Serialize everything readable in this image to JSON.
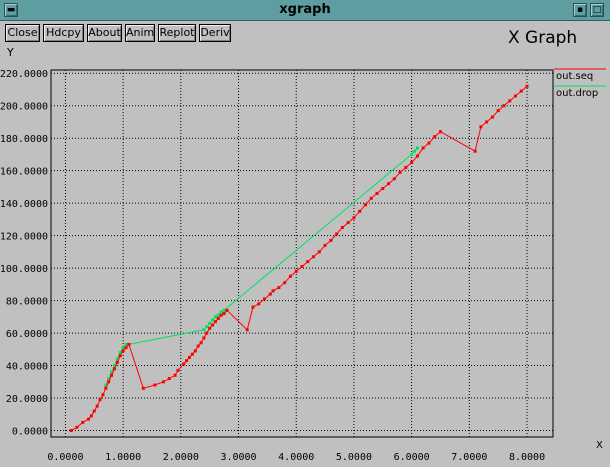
{
  "window": {
    "title": "xgraph"
  },
  "buttons": [
    "Close",
    "Hdcpy",
    "About",
    "Anim",
    "Replot",
    "Deriv"
  ],
  "graph": {
    "title": "X Graph",
    "ylabel": "Y",
    "xlabel": "X"
  },
  "colors": {
    "seq": "#ff0000",
    "drop": "#00e060",
    "grid": "#000000",
    "background": "#c0c0c0",
    "titlebar": "#5f9ea0"
  },
  "chart_data": {
    "type": "line",
    "title": "X Graph",
    "xlabel": "X",
    "ylabel": "Y",
    "xlim": [
      -0.25,
      8.45
    ],
    "ylim": [
      -4,
      222
    ],
    "grid": true,
    "legend_position": "top-right",
    "xticks": [
      "0.0000",
      "1.0000",
      "2.0000",
      "3.0000",
      "4.0000",
      "5.0000",
      "6.0000",
      "7.0000",
      "8.0000"
    ],
    "yticks": [
      "0.0000",
      "20.0000",
      "40.0000",
      "60.0000",
      "80.0000",
      "100.0000",
      "120.0000",
      "140.0000",
      "160.0000",
      "180.0000",
      "200.0000",
      "220.0000"
    ],
    "series": [
      {
        "name": "out.seq",
        "color": "#ff0000",
        "x": [
          0.1,
          0.2,
          0.3,
          0.4,
          0.45,
          0.5,
          0.55,
          0.6,
          0.65,
          0.7,
          0.75,
          0.8,
          0.85,
          0.9,
          0.95,
          1.0,
          1.05,
          1.1,
          1.35,
          1.55,
          1.7,
          1.8,
          1.9,
          1.95,
          2.05,
          2.1,
          2.15,
          2.2,
          2.25,
          2.3,
          2.35,
          2.4,
          2.45,
          2.5,
          2.55,
          2.6,
          2.65,
          2.7,
          2.75,
          2.8,
          3.15,
          3.25,
          3.35,
          3.45,
          3.55,
          3.6,
          3.7,
          3.8,
          3.9,
          4.0,
          4.1,
          4.2,
          4.3,
          4.4,
          4.5,
          4.6,
          4.7,
          4.8,
          4.9,
          5.0,
          5.1,
          5.2,
          5.3,
          5.4,
          5.5,
          5.6,
          5.7,
          5.8,
          5.9,
          6.0,
          6.1,
          6.2,
          6.3,
          6.4,
          6.5,
          7.1,
          7.2,
          7.3,
          7.4,
          7.5,
          7.6,
          7.7,
          7.8,
          7.9,
          8.0
        ],
        "y": [
          0,
          2,
          5,
          7,
          9,
          12,
          15,
          19,
          22,
          26,
          30,
          34,
          38,
          42,
          46,
          49,
          51,
          53,
          26,
          28,
          30,
          32,
          34,
          37,
          41,
          43,
          45,
          47,
          49,
          52,
          54,
          57,
          60,
          63,
          65,
          67,
          69,
          71,
          72,
          74,
          62,
          76,
          78,
          81,
          84,
          86,
          88,
          91,
          95,
          98,
          101,
          104,
          107,
          110,
          114,
          117,
          121,
          125,
          128,
          131,
          135,
          139,
          143,
          146,
          149,
          152,
          155,
          159,
          162,
          165,
          169,
          174,
          177,
          181,
          184,
          172,
          187,
          190,
          193,
          197,
          200,
          203,
          206,
          209,
          212
        ]
      },
      {
        "name": "out.drop",
        "color": "#00e060",
        "x": [
          0.7,
          0.75,
          0.8,
          0.85,
          0.9,
          0.95,
          1.0,
          1.05,
          1.1,
          2.4,
          2.45,
          2.5,
          2.55,
          2.6,
          2.65,
          2.7,
          2.75,
          6.0,
          6.05,
          6.1
        ],
        "y": [
          28,
          32,
          36,
          40,
          44,
          48,
          51,
          53,
          53,
          62,
          64,
          66,
          68,
          70,
          71,
          73,
          74,
          170,
          172,
          174
        ]
      }
    ]
  }
}
